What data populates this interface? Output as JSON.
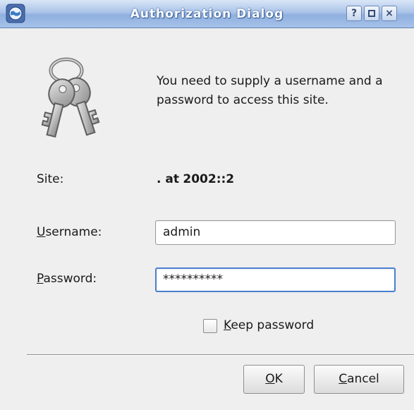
{
  "window": {
    "title": "Authorization Dialog",
    "help_label": "?",
    "close_label": "×"
  },
  "message": "You need to supply a username and a password to access this site.",
  "site": {
    "label": "Site:",
    "value_prefix": ". at",
    "value_host": "2002::2"
  },
  "username": {
    "label_mnemonic": "U",
    "label_rest": "sername:",
    "value": "admin"
  },
  "password": {
    "label_mnemonic": "P",
    "label_rest": "assword:",
    "value": "**********"
  },
  "keep_password": {
    "label_mnemonic": "K",
    "label_rest": "eep password",
    "checked": false
  },
  "buttons": {
    "ok_mnemonic": "O",
    "ok_rest": "K",
    "cancel_mnemonic": "C",
    "cancel_rest": "ancel"
  },
  "colors": {
    "titlebar": "#a9c3e8",
    "focus_border": "#4a7fd1",
    "dialog_bg": "#efefef"
  }
}
